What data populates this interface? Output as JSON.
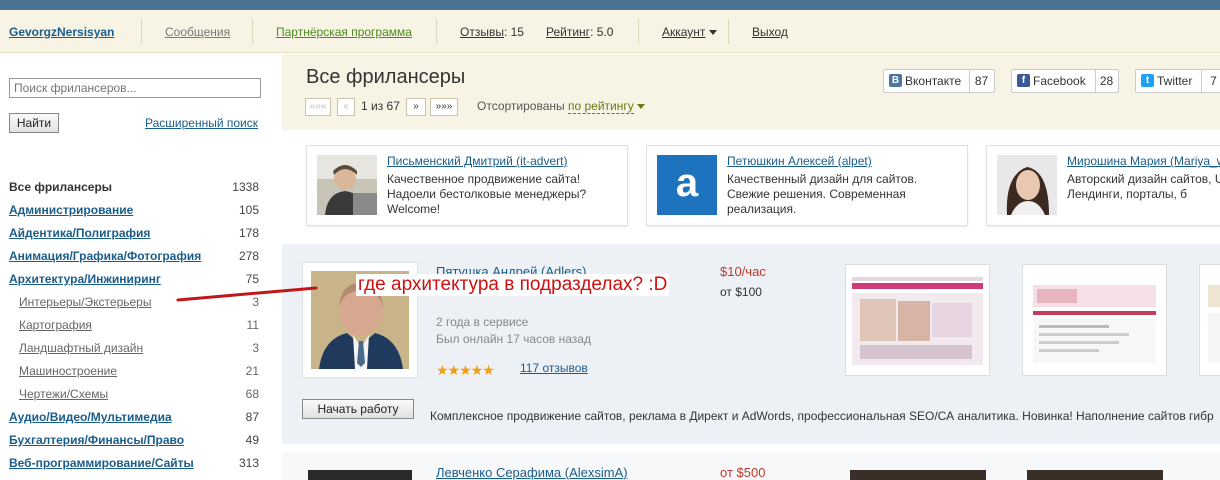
{
  "topnav": {
    "username": "GevorgzNersisyan",
    "messages": "Сообщения",
    "partner": "Партнёрская программа",
    "reviews_label": "Отзывы",
    "reviews_count": ": 15",
    "rating_label": "Рейтинг",
    "rating_value": ": 5.0",
    "account": "Аккаунт",
    "logout": "Выход"
  },
  "sidebar": {
    "search_placeholder": "Поиск фрилансеров...",
    "search_button": "Найти",
    "advanced_search": "Расширенный поиск",
    "categories": [
      {
        "name": "Все фрилансеры",
        "count": "1338"
      },
      {
        "name": "Администрирование",
        "count": "105"
      },
      {
        "name": "Айдентика/Полиграфия",
        "count": "178"
      },
      {
        "name": "Анимация/Графика/Фотография",
        "count": "278"
      },
      {
        "name": "Архитектура/Инжиниринг",
        "count": "75"
      },
      {
        "name": "Интерьеры/Экстерьеры",
        "count": "3"
      },
      {
        "name": "Картография",
        "count": "11"
      },
      {
        "name": "Ландшафтный дизайн",
        "count": "3"
      },
      {
        "name": "Машиностроение",
        "count": "21"
      },
      {
        "name": "Чертежи/Схемы",
        "count": "68"
      },
      {
        "name": "Аудио/Видео/Мультимедиа",
        "count": "87"
      },
      {
        "name": "Бухгалтерия/Финансы/Право",
        "count": "49"
      },
      {
        "name": "Веб-программирование/Сайты",
        "count": "313"
      }
    ]
  },
  "main": {
    "title": "Все фрилансеры",
    "pagination": {
      "first": "«««",
      "prev": "«",
      "info": "1 из 67",
      "next": "»",
      "last": "»»»"
    },
    "sort_prefix": "Отсортированы",
    "sort_value": "по рейтингу"
  },
  "social": [
    {
      "name": "Вконтакте",
      "count": "87",
      "icon": "vk-icon",
      "color": "#4c75a3",
      "glyph": "B"
    },
    {
      "name": "Facebook",
      "count": "28",
      "icon": "facebook-icon",
      "color": "#3b5998",
      "glyph": "f"
    },
    {
      "name": "Twitter",
      "count": "7",
      "icon": "twitter-icon",
      "color": "#1da1f2",
      "glyph": "t"
    }
  ],
  "promos": [
    {
      "title": "Письменский Дмитрий (it-advert)",
      "desc": "Качественное продвижение сайта! Надоели бестолковые менеджеры? Welcome!"
    },
    {
      "title": "Петюшкин Алексей (alpet)",
      "desc": "Качественный дизайн для сайтов. Свежие решения. Современная реализация.",
      "logo": "a"
    },
    {
      "title": "Мирошина Мария (Mariya_w",
      "desc": "Авторский дизайн сайтов, UX. Лендинги, порталы, б"
    }
  ],
  "freelancers": [
    {
      "name": "Пятушка Андрей (Adlers)",
      "rate": "$10/час",
      "from": "от $100",
      "service": "2 года в сервисе",
      "online": "Был онлайн 17 часов назад",
      "stars": "★★★★★",
      "reviews": "117 отзывов",
      "start_button": "Начать работу",
      "description": "Комплексное продвижение сайтов, реклама в Директ и AdWords, профессиональная SEO/СА аналитика. Новинка! Наполнение сайтов гибр"
    },
    {
      "name": "Левченко Серафима (AlexsimA)",
      "rate": "от $500"
    }
  ],
  "annotation": "где архитектура в подразделах? :D",
  "colors": {
    "link": "#1a5d8c",
    "accent_red": "#d01010",
    "header_bg": "#f7f4e6",
    "card_bg": "#edf0f4"
  }
}
